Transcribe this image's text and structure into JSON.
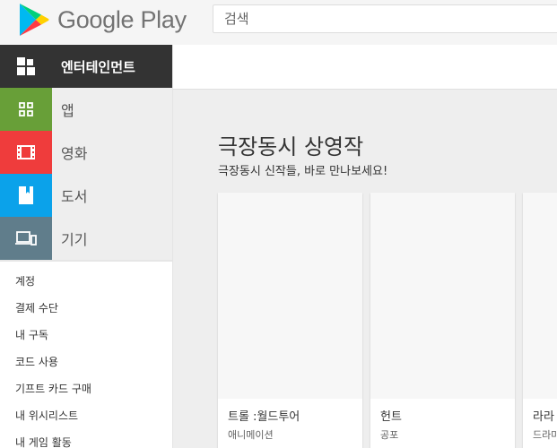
{
  "header": {
    "logo_text": "Google Play",
    "search_placeholder": "검색"
  },
  "sidebar": {
    "categories": [
      {
        "label": "엔터테인먼트",
        "icon": "entertainment-icon",
        "color": "#333333"
      },
      {
        "label": "앱",
        "icon": "apps-grid-icon",
        "color": "#689f38"
      },
      {
        "label": "영화",
        "icon": "film-icon",
        "color": "#ef3c3c"
      },
      {
        "label": "도서",
        "icon": "book-icon",
        "color": "#0ba2ea"
      },
      {
        "label": "기기",
        "icon": "devices-icon",
        "color": "#607d8b"
      }
    ],
    "links": [
      "계정",
      "결제 수단",
      "내 구독",
      "코드 사용",
      "기프트 카드 구매",
      "내 위시리스트",
      "내 게임 활동"
    ]
  },
  "main": {
    "section_title": "극장동시 상영작",
    "section_subtitle": "극장동시 신작들, 바로 만나보세요!",
    "cards": [
      {
        "title": "트롤 :월드투어",
        "genre": "애니메이션"
      },
      {
        "title": "헌트",
        "genre": "공포"
      },
      {
        "title": "라라",
        "genre": "드라마"
      }
    ]
  }
}
